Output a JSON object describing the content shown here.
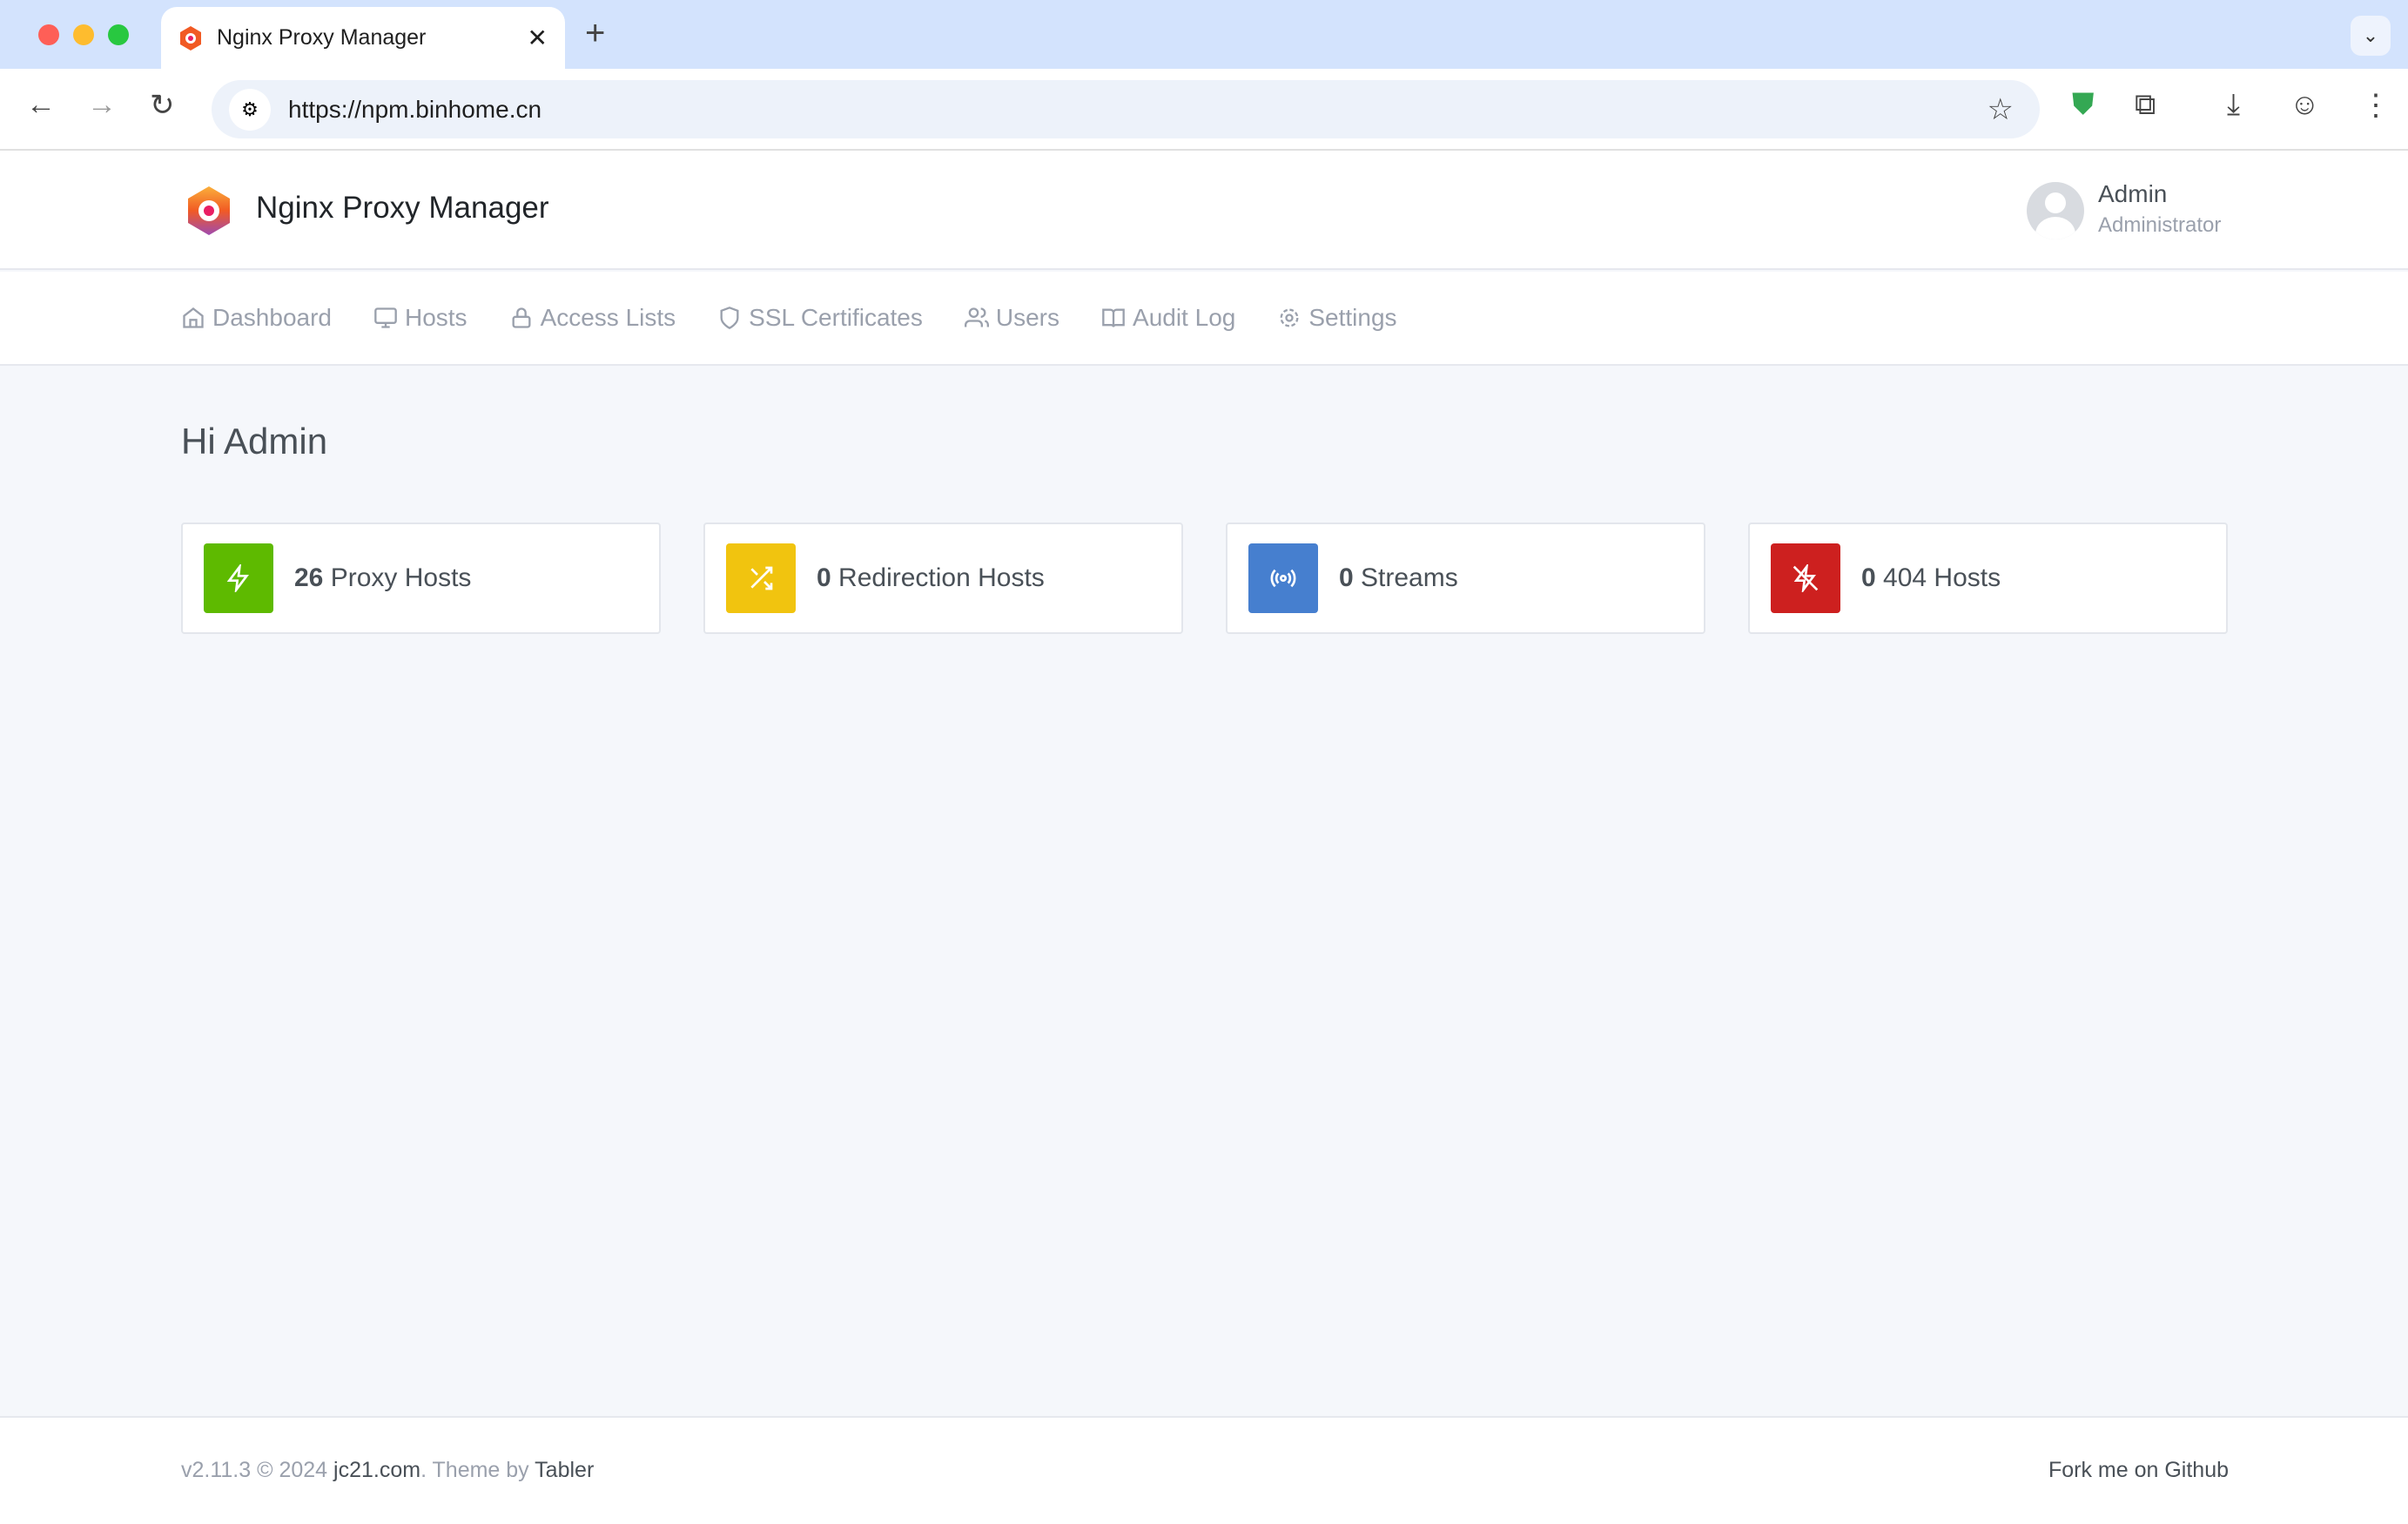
{
  "browser": {
    "tab_title": "Nginx Proxy Manager",
    "url": "https://npm.binhome.cn",
    "icons": [
      "back-icon",
      "forward-icon",
      "reload-icon",
      "site-info-icon",
      "star-icon",
      "shield-extension-icon",
      "extensions-icon",
      "download-icon",
      "profile-icon",
      "menu-icon"
    ]
  },
  "app": {
    "title": "Nginx Proxy Manager",
    "user": {
      "name": "Admin",
      "role": "Administrator"
    }
  },
  "nav": [
    {
      "label": "Dashboard",
      "icon": "home-icon"
    },
    {
      "label": "Hosts",
      "icon": "monitor-icon"
    },
    {
      "label": "Access Lists",
      "icon": "lock-icon"
    },
    {
      "label": "SSL Certificates",
      "icon": "shield-icon"
    },
    {
      "label": "Users",
      "icon": "users-icon"
    },
    {
      "label": "Audit Log",
      "icon": "book-icon"
    },
    {
      "label": "Settings",
      "icon": "gear-icon"
    }
  ],
  "greeting": "Hi Admin",
  "cards": [
    {
      "count": "26",
      "label": "Proxy Hosts",
      "color": "#5eba00",
      "icon": "zap-icon"
    },
    {
      "count": "0",
      "label": "Redirection Hosts",
      "color": "#f1c40f",
      "icon": "shuffle-icon"
    },
    {
      "count": "0",
      "label": "Streams",
      "color": "#467fcf",
      "icon": "radio-icon"
    },
    {
      "count": "0",
      "label": "404 Hosts",
      "color": "#cd201f",
      "icon": "zap-off-icon"
    }
  ],
  "footer": {
    "version": "v2.11.3 © 2024 ",
    "author": "jc21.com",
    "theme_prefix": ". Theme by ",
    "theme": "Tabler",
    "github": "Fork me on Github"
  }
}
